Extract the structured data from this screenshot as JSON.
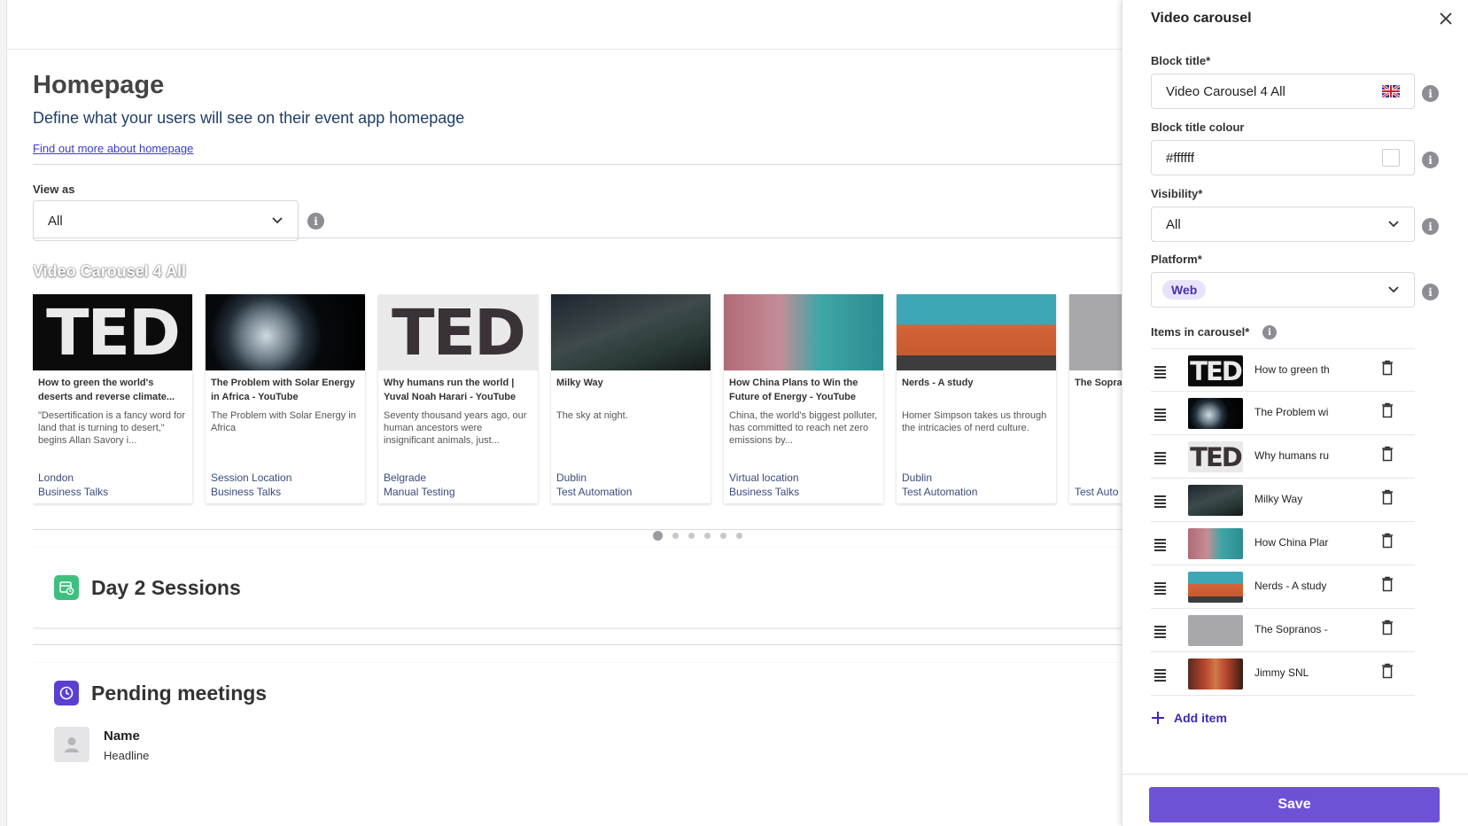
{
  "page": {
    "title": "Homepage",
    "subtitle": "Define what your users will see on their event app homepage",
    "link": "Find out more about homepage"
  },
  "view_as": {
    "label": "View as",
    "value": "All"
  },
  "carousel": {
    "title": "Video Carousel 4 All",
    "cards": [
      {
        "title": "How to green the world's deserts and reverse climate...",
        "desc": "\"Desertification is a fancy word for land that is turning to desert,\" begins Allan Savory i...",
        "location": "London",
        "track": "Business Talks",
        "thumb": "ted-dark"
      },
      {
        "title": "The Problem with Solar Energy in Africa - YouTube",
        "desc": "The Problem with Solar Energy in Africa",
        "location": "Session Location",
        "track": "Business Talks",
        "thumb": "earth"
      },
      {
        "title": "Why humans run the world | Yuval Noah Harari - YouTube",
        "desc": "Seventy thousand years ago, our human ancestors were insignificant animals, just...",
        "location": "Belgrade",
        "track": "Manual Testing",
        "thumb": "ted-light"
      },
      {
        "title": "Milky Way",
        "desc": "The sky at night.",
        "location": "Dublin",
        "track": "Test Automation",
        "thumb": "milky-way"
      },
      {
        "title": "How China Plans to Win the Future of Energy - YouTube",
        "desc": "China, the world's biggest polluter, has committed to reach net zero emissions by...",
        "location": "Virtual location",
        "track": "Business Talks",
        "thumb": "china"
      },
      {
        "title": "Nerds - A study",
        "desc": "Homer Simpson takes us through the intricacies of nerd culture.",
        "location": "Dublin",
        "track": "Test Automation",
        "thumb": "simpsons"
      },
      {
        "title": "The Sopra - YouTube",
        "desc": "",
        "location": "",
        "track": "Test Auto",
        "thumb": "gray"
      }
    ],
    "pages": 6,
    "active_page": 0
  },
  "blocks": {
    "sessions_title": "Day 2 Sessions",
    "meetings_title": "Pending meetings",
    "meeting_name": "Name",
    "meeting_headline": "Headline"
  },
  "panel": {
    "header": "Video carousel",
    "block_title_label": "Block title*",
    "block_title_value": "Video Carousel 4 All",
    "block_title_colour_label": "Block title colour",
    "block_title_colour_value": "#ffffff",
    "visibility_label": "Visibility*",
    "visibility_value": "All",
    "platform_label": "Platform*",
    "platform_chip": "Web",
    "items_label": "Items in carousel*",
    "items": [
      {
        "label": "How to green th",
        "thumb": "ted-dark"
      },
      {
        "label": "The Problem wi",
        "thumb": "earth"
      },
      {
        "label": "Why humans ru",
        "thumb": "ted-light"
      },
      {
        "label": "Milky Way",
        "thumb": "milky-way"
      },
      {
        "label": "How China Plar",
        "thumb": "china"
      },
      {
        "label": "Nerds - A study",
        "thumb": "simpsons"
      },
      {
        "label": "The Sopranos -",
        "thumb": "gray"
      },
      {
        "label": "Jimmy SNL",
        "thumb": "snl"
      }
    ],
    "add_item": "Add item",
    "save": "Save"
  },
  "colors": {
    "accent": "#6e52d6",
    "link": "#3b3bd6",
    "session_icon": "#3fbf7f",
    "meetings_icon": "#5b3fd1"
  }
}
